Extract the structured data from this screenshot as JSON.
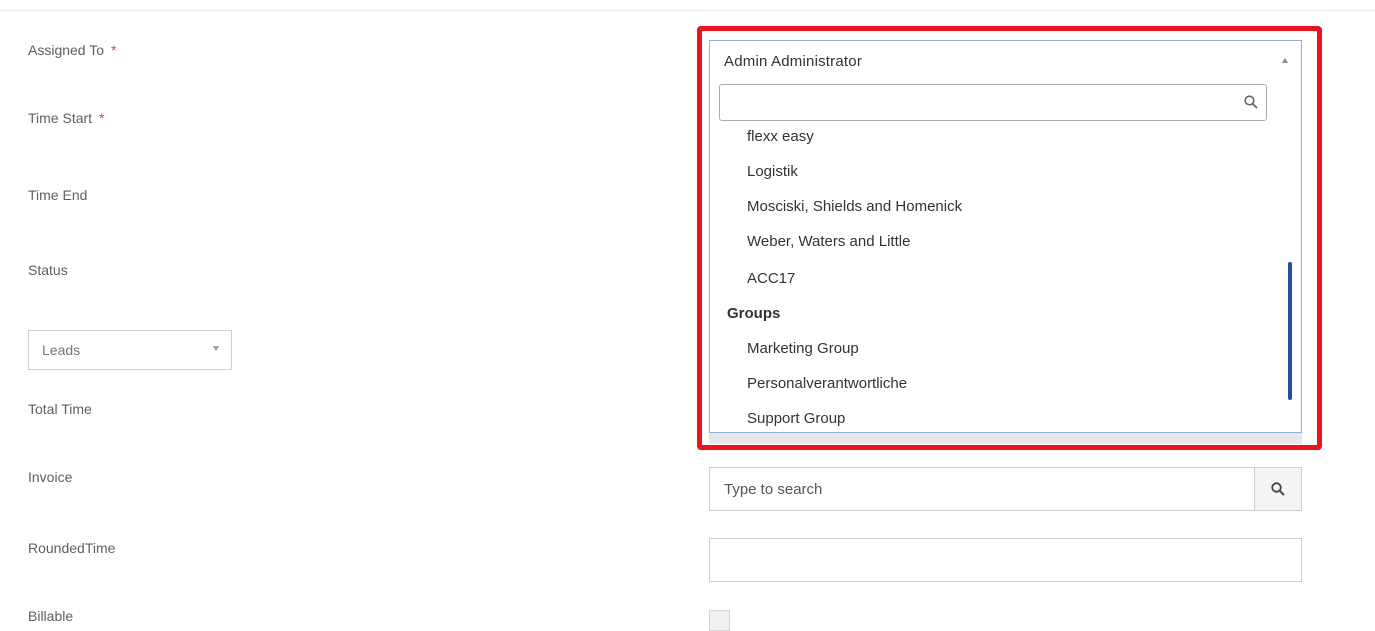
{
  "form": {
    "assigned_to_label": "Assigned To",
    "time_start_label": "Time Start",
    "time_end_label": "Time End",
    "status_label": "Status",
    "total_time_label": "Total Time",
    "invoice_label": "Invoice",
    "rounded_time_label": "RoundedTime",
    "billable_label": "Billable",
    "required_marker": "*",
    "leads_value": "Leads"
  },
  "assigned_select": {
    "value": "Admin Administrator",
    "search_value": "",
    "options": [
      "flexx easy",
      "Logistik",
      "Mosciski, Shields and Homenick",
      "Weber, Waters and Little",
      "ACC17"
    ],
    "group_heading": "Groups",
    "group_options": [
      "Marketing Group",
      "Personalverantwortliche",
      "Support Group"
    ]
  },
  "invoice": {
    "placeholder": "Type to search"
  },
  "rounded_time": {
    "value": ""
  },
  "billable": {
    "checked": false
  },
  "colors": {
    "highlight": "#ea1320",
    "scrollbar": "#244f9e",
    "focus_border": "#8db3d9",
    "required": "#e8403a"
  },
  "icons": {
    "dropdown_search": "search-icon",
    "invoice_search": "search-icon"
  }
}
